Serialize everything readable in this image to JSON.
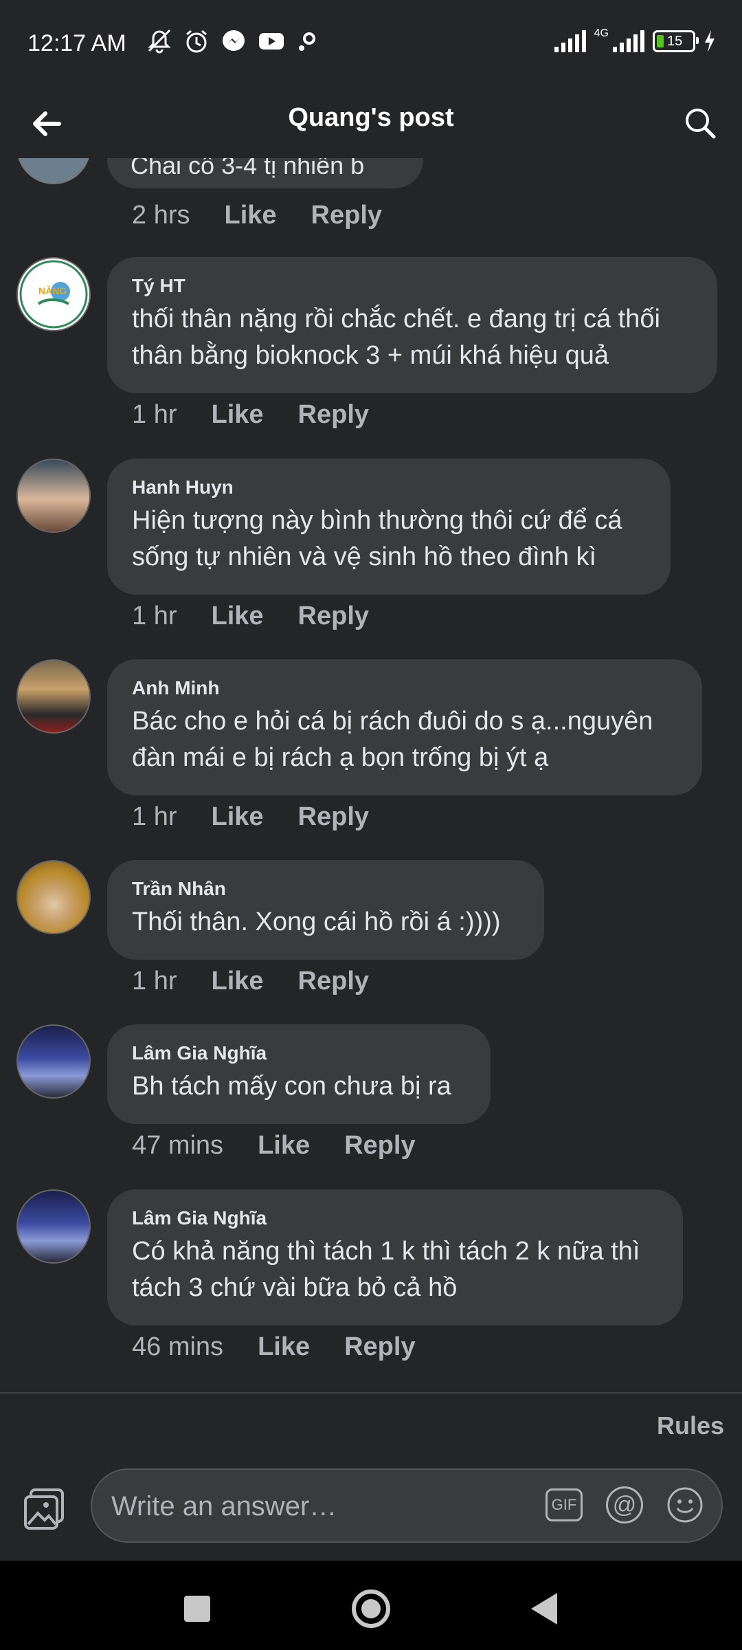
{
  "status_bar": {
    "time": "12:17 AM",
    "network": "4G",
    "battery": "15",
    "icons_left": [
      "mute-icon",
      "alarm-icon",
      "messenger-icon",
      "youtube-icon",
      "settings-icon"
    ]
  },
  "header": {
    "title": "Quang's post"
  },
  "previous_comment": {
    "text_partial": "Chai cố 3-4 tị nhiễn b",
    "time": "2 hrs",
    "like": "Like",
    "reply": "Reply"
  },
  "comments": [
    {
      "author": "Tý HT",
      "text": "thối thân nặng rồi chắc chết. e đang trị cá thối thân bằng bioknock 3 + múi khá hiệu quả",
      "time": "1 hr",
      "like": "Like",
      "reply": "Reply",
      "avatar_logo": "NĂNG"
    },
    {
      "author": "Hanh Huyn",
      "text": "Hiện tượng này bình thường thôi  cứ để cá sống tự nhiên và vệ sinh hồ theo đình kì",
      "time": "1 hr",
      "like": "Like",
      "reply": "Reply"
    },
    {
      "author": "Anh Minh",
      "text": "Bác cho e hỏi cá bị rách đuôi do s ạ...nguyên đàn mái e bị rách ạ bọn trống bị ýt ạ",
      "time": "1 hr",
      "like": "Like",
      "reply": "Reply"
    },
    {
      "author": "Trần Nhân",
      "text": "Thối thân. Xong cái hồ rồi á :))))",
      "time": "1 hr",
      "like": "Like",
      "reply": "Reply"
    },
    {
      "author": "Lâm Gia Nghĩa",
      "text": "Bh tách mấy con chưa bị ra",
      "time": "47 mins",
      "like": "Like",
      "reply": "Reply"
    },
    {
      "author": "Lâm Gia Nghĩa",
      "text": "Có khả năng thì tách 1 k thì tách 2 k nữa thì tách 3 chứ vài bữa bỏ cả hồ",
      "time": "46 mins",
      "like": "Like",
      "reply": "Reply"
    }
  ],
  "footer": {
    "rules": "Rules",
    "composer_placeholder": "Write an answer…",
    "gif": "GIF",
    "at_symbol": "@"
  },
  "colors": {
    "background": "#242526",
    "bubble": "#3a3b3c",
    "text": "#e4e6eb",
    "muted": "#b0b3b8"
  }
}
